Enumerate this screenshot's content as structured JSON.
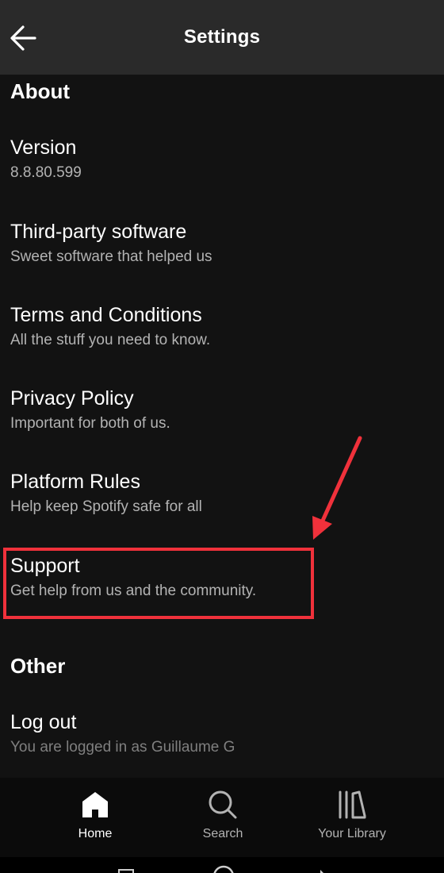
{
  "header": {
    "title": "Settings",
    "back_icon": "arrow-left-icon"
  },
  "sections": {
    "about": {
      "heading": "About",
      "items": [
        {
          "title": "Version",
          "subtitle": "8.8.80.599"
        },
        {
          "title": "Third-party software",
          "subtitle": "Sweet software that helped us"
        },
        {
          "title": "Terms and Conditions",
          "subtitle": "All the stuff you need to know."
        },
        {
          "title": "Privacy Policy",
          "subtitle": "Important for both of us."
        },
        {
          "title": "Platform Rules",
          "subtitle": "Help keep Spotify safe for all"
        },
        {
          "title": "Support",
          "subtitle": "Get help from us and the community."
        }
      ]
    },
    "other": {
      "heading": "Other",
      "items": [
        {
          "title": "Log out",
          "subtitle": "You are logged in as Guillaume G"
        }
      ]
    }
  },
  "annotation": {
    "highlight_color": "#f0313b",
    "highlighted_item": "Support"
  },
  "bottom_nav": {
    "items": [
      {
        "label": "Home",
        "icon": "home-icon",
        "active": true
      },
      {
        "label": "Search",
        "icon": "search-icon",
        "active": false
      },
      {
        "label": "Your Library",
        "icon": "library-icon",
        "active": false
      }
    ]
  },
  "system_nav": {
    "icons": [
      "recents-icon",
      "home-circle-icon",
      "back-triangle-icon"
    ]
  },
  "colors": {
    "background": "#121212",
    "header": "#2a2a2a",
    "subtitle": "#b3b3b3",
    "nav_background": "#0b0b0b"
  }
}
